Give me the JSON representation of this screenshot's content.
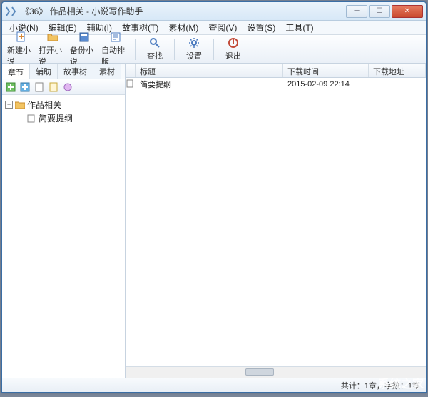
{
  "window": {
    "title": "《36》 作品相关 - 小说写作助手"
  },
  "menu": {
    "items": [
      {
        "label": "小说(N)"
      },
      {
        "label": "编辑(E)"
      },
      {
        "label": "辅助(I)"
      },
      {
        "label": "故事树(T)"
      },
      {
        "label": "素材(M)"
      },
      {
        "label": "查阅(V)"
      },
      {
        "label": "设置(S)"
      },
      {
        "label": "工具(T)"
      }
    ]
  },
  "toolbar": {
    "buttons": [
      {
        "label": "新建小说",
        "icon": "new-doc-icon"
      },
      {
        "label": "打开小说",
        "icon": "open-folder-icon"
      },
      {
        "label": "备份小说",
        "icon": "save-icon"
      },
      {
        "label": "自动排版",
        "icon": "layout-icon"
      },
      {
        "label": "查找",
        "icon": "search-icon"
      },
      {
        "label": "设置",
        "icon": "gear-icon"
      },
      {
        "label": "退出",
        "icon": "exit-icon"
      }
    ]
  },
  "left_panel": {
    "tabs": [
      {
        "label": "章节",
        "active": true
      },
      {
        "label": "辅助"
      },
      {
        "label": "故事树"
      },
      {
        "label": "素材"
      }
    ],
    "tree": {
      "root": {
        "label": "作品相关",
        "expanded": true
      },
      "children": [
        {
          "label": "简要提纲",
          "icon": "page-icon"
        }
      ]
    }
  },
  "list": {
    "columns": [
      "",
      "标题",
      "下载时间",
      "下载地址"
    ],
    "rows": [
      {
        "icon": "page-icon",
        "title": "简要提纲",
        "time": "2015-02-09 22:14",
        "url": ""
      }
    ]
  },
  "statusbar": {
    "text": "共计：1章，字数：1章"
  },
  "watermark": "系统之家"
}
